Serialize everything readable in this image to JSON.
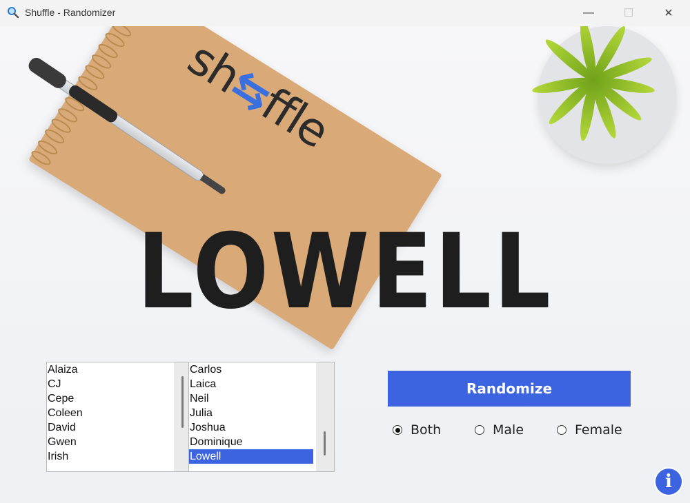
{
  "window": {
    "title": "Shuffle - Randomizer",
    "icon": "magnifier-icon",
    "minimize_icon": "minimize-icon",
    "maximize_icon": "maximize-icon",
    "close_icon": "close-icon"
  },
  "header_image": {
    "logo_text_1": "sh",
    "logo_text_2": "ffle"
  },
  "result": {
    "name": "LOWELL"
  },
  "list_left": {
    "items": [
      "Alaiza",
      "CJ",
      "Cepe",
      "Coleen",
      "David",
      "Gwen",
      "Irish"
    ]
  },
  "list_right": {
    "items": [
      "Carlos",
      "Laica",
      "Neil",
      "Julia",
      "Joshua",
      "Dominique",
      "Lowell"
    ],
    "selected": "Lowell"
  },
  "controls": {
    "randomize_label": "Randomize",
    "radio_both": "Both",
    "radio_male": "Male",
    "radio_female": "Female",
    "selected_radio": "Both",
    "info_label": "i"
  },
  "colors": {
    "accent": "#3c64e0"
  }
}
